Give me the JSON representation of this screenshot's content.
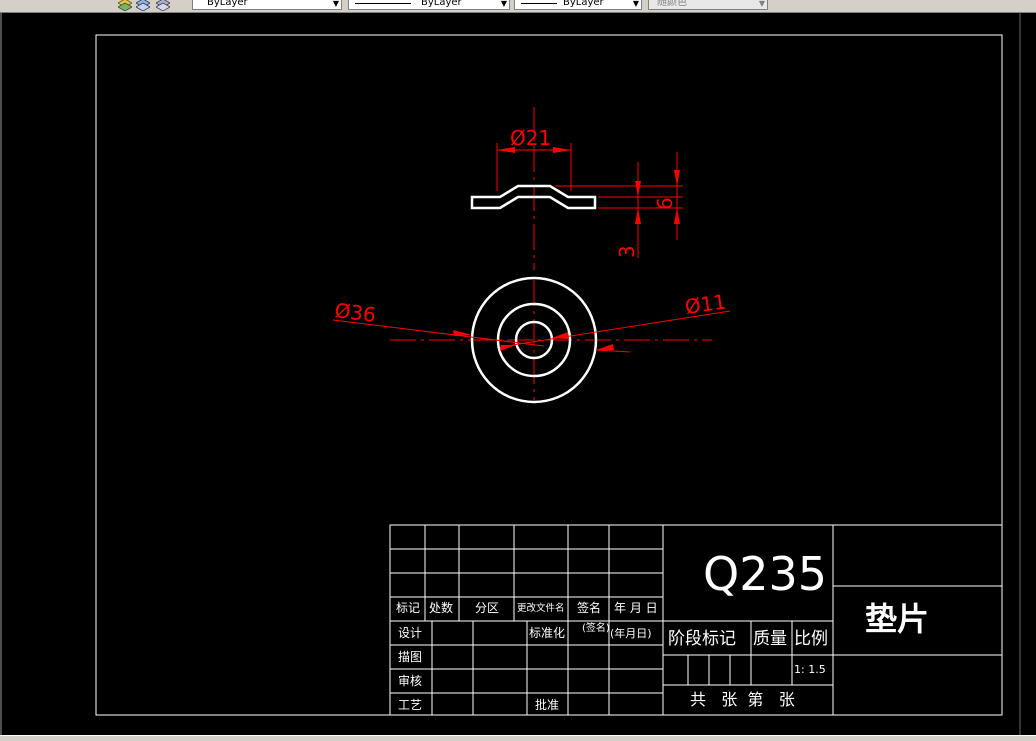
{
  "toolbar": {
    "color_combo": "ByLayer",
    "linetype_combo": "ByLayer",
    "lineweight_combo": "ByLayer",
    "plotstyle_combo": "随颜色"
  },
  "drawing": {
    "dimensions": {
      "d21": "Ø21",
      "h6": "6",
      "t3": "3",
      "d36": "Ø36",
      "d11": "Ø11"
    },
    "title_block": {
      "material": "Q235",
      "part_name": "垫片",
      "labels": {
        "mark": "标记",
        "count": "处数",
        "zone": "分区",
        "change_doc": "更改文件名",
        "sign": "签名",
        "date": "年 月 日",
        "design": "设计",
        "standard": "标准化",
        "sign_paren": "(签名)",
        "date_paren": "(年月日)",
        "stage_mark": "阶段标记",
        "weight": "质量",
        "scale_label": "比例",
        "scale_value": "1: 1.5",
        "drawing": "描图",
        "review": "审核",
        "process": "工艺",
        "approve": "批准",
        "sheets": "共   张  第   张"
      }
    }
  }
}
